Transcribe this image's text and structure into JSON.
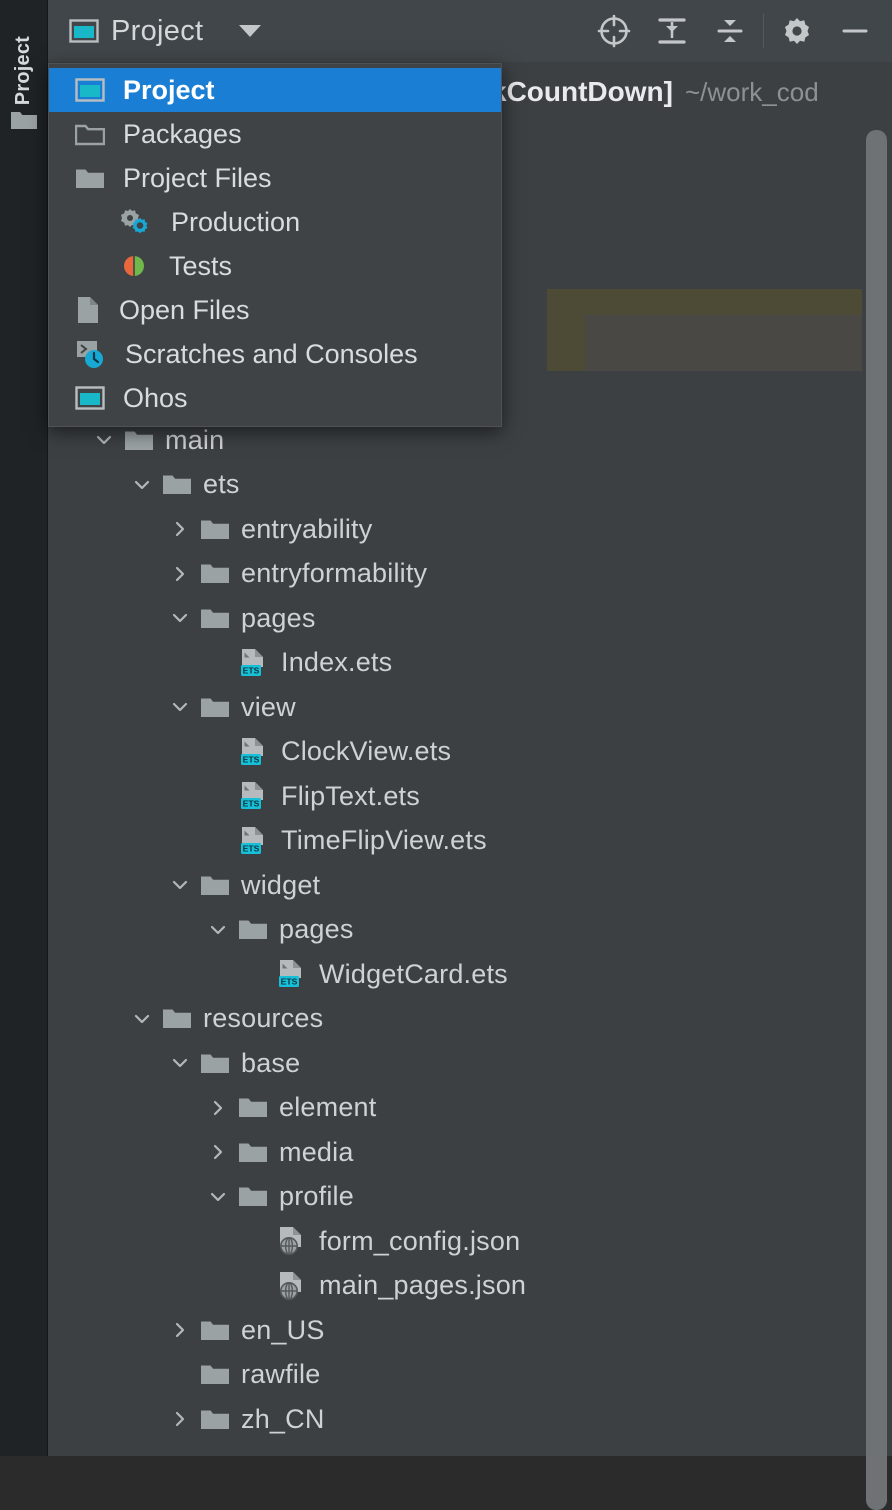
{
  "tool_strip": {
    "tab_label": "Project",
    "folder_icon": "folder-icon"
  },
  "header": {
    "title": "Project",
    "view_icon": "project-view-icon",
    "dropdown_icon": "chevron-down-icon",
    "actions": [
      {
        "name": "select-opened-file-icon",
        "label": "Select Opened File"
      },
      {
        "name": "expand-all-icon",
        "label": "Expand All"
      },
      {
        "name": "collapse-all-icon",
        "label": "Collapse All"
      },
      {
        "name": "gear-icon",
        "label": "Options"
      },
      {
        "name": "minimize-icon",
        "label": "Hide"
      }
    ]
  },
  "background_row": {
    "project_name": "kCountDown]",
    "project_path": "~/work_cod"
  },
  "popup": {
    "items": [
      {
        "label": "Project",
        "icon": "project-view-icon",
        "selected": true,
        "indent": false
      },
      {
        "label": "Packages",
        "icon": "packages-folder-icon",
        "selected": false,
        "indent": false
      },
      {
        "label": "Project Files",
        "icon": "folder-icon",
        "selected": false,
        "indent": false
      },
      {
        "label": "Production",
        "icon": "production-gears-icon",
        "selected": false,
        "indent": true
      },
      {
        "label": "Tests",
        "icon": "tests-split-circle-icon",
        "selected": false,
        "indent": true
      },
      {
        "label": "Open Files",
        "icon": "open-files-icon",
        "selected": false,
        "indent": false
      },
      {
        "label": "Scratches and Consoles",
        "icon": "scratches-consoles-icon",
        "selected": false,
        "indent": false
      },
      {
        "label": "Ohos",
        "icon": "ohos-view-icon",
        "selected": false,
        "indent": false
      }
    ]
  },
  "tree": {
    "rows": [
      {
        "label": "main",
        "icon": "folder-icon",
        "twisty": "expanded",
        "depth": 4
      },
      {
        "label": "ets",
        "icon": "folder-icon",
        "twisty": "expanded",
        "depth": 5
      },
      {
        "label": "entryability",
        "icon": "folder-icon",
        "twisty": "collapsed",
        "depth": 6
      },
      {
        "label": "entryformability",
        "icon": "folder-icon",
        "twisty": "collapsed",
        "depth": 6
      },
      {
        "label": "pages",
        "icon": "folder-icon",
        "twisty": "expanded",
        "depth": 6
      },
      {
        "label": "Index.ets",
        "icon": "ets-file-icon",
        "twisty": "none",
        "depth": 7
      },
      {
        "label": "view",
        "icon": "folder-icon",
        "twisty": "expanded",
        "depth": 6
      },
      {
        "label": "ClockView.ets",
        "icon": "ets-file-icon",
        "twisty": "none",
        "depth": 7
      },
      {
        "label": "FlipText.ets",
        "icon": "ets-file-icon",
        "twisty": "none",
        "depth": 7
      },
      {
        "label": "TimeFlipView.ets",
        "icon": "ets-file-icon",
        "twisty": "none",
        "depth": 7
      },
      {
        "label": "widget",
        "icon": "folder-icon",
        "twisty": "expanded",
        "depth": 6
      },
      {
        "label": "pages",
        "icon": "folder-icon",
        "twisty": "expanded",
        "depth": 7
      },
      {
        "label": "WidgetCard.ets",
        "icon": "ets-file-icon",
        "twisty": "none",
        "depth": 8
      },
      {
        "label": "resources",
        "icon": "folder-icon",
        "twisty": "expanded",
        "depth": 5
      },
      {
        "label": "base",
        "icon": "folder-icon",
        "twisty": "expanded",
        "depth": 6
      },
      {
        "label": "element",
        "icon": "folder-icon",
        "twisty": "collapsed",
        "depth": 7
      },
      {
        "label": "media",
        "icon": "folder-icon",
        "twisty": "collapsed",
        "depth": 7
      },
      {
        "label": "profile",
        "icon": "folder-icon",
        "twisty": "expanded",
        "depth": 7
      },
      {
        "label": "form_config.json",
        "icon": "json-file-icon",
        "twisty": "none",
        "depth": 8
      },
      {
        "label": "main_pages.json",
        "icon": "json-file-icon",
        "twisty": "none",
        "depth": 8
      },
      {
        "label": "en_US",
        "icon": "folder-icon",
        "twisty": "collapsed",
        "depth": 6
      },
      {
        "label": "rawfile",
        "icon": "folder-icon",
        "twisty": "none",
        "depth": 6
      },
      {
        "label": "zh_CN",
        "icon": "folder-icon",
        "twisty": "collapsed",
        "depth": 6
      }
    ]
  },
  "colors": {
    "panel_bg": "#3c4043",
    "header_bg": "#41464a",
    "selection_blue": "#1a7fd4",
    "popup_bg": "#3f4346",
    "text": "#cfd2d4",
    "folder": "#9aa2a3",
    "ets_badge": "#16c0d8",
    "highlight_olive": "#4d4a36"
  },
  "scrollbar": {
    "name": "vertical-scrollbar"
  }
}
